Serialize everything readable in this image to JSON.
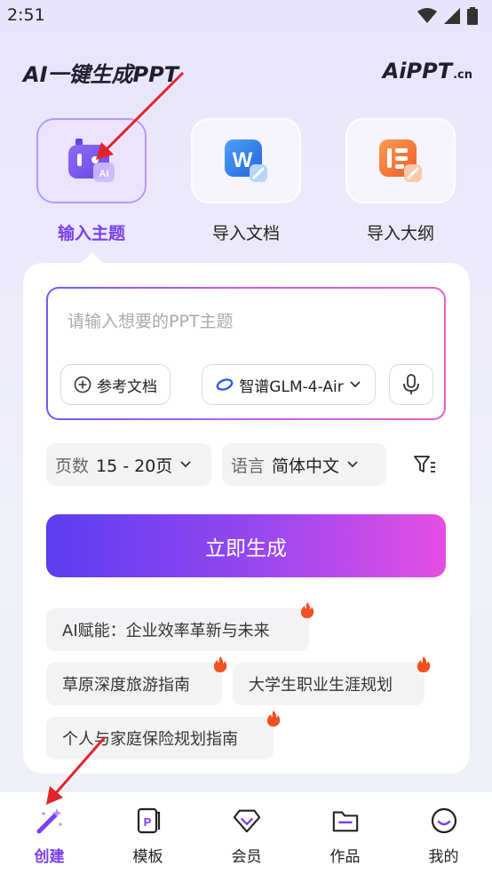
{
  "status_bar": {
    "time": "2:51"
  },
  "header": {
    "title": "AI一键生成PPT",
    "logo_main": "AiPPT",
    "logo_suffix": ".cn"
  },
  "modes": [
    {
      "label": "输入主题",
      "icon": "robot-ai-icon",
      "active": true
    },
    {
      "label": "导入文档",
      "icon": "word-doc-icon",
      "active": false
    },
    {
      "label": "导入大纲",
      "icon": "outline-doc-icon",
      "active": false
    }
  ],
  "prompt": {
    "placeholder": "请输入想要的PPT主题",
    "reference_button": "参考文档",
    "model_selector": "智谱GLM-4-Air"
  },
  "options": {
    "pages_label": "页数",
    "pages_value": "15 - 20页",
    "language_label": "语言",
    "language_value": "简体中文"
  },
  "generate_button": "立即生成",
  "suggestions": [
    "AI赋能：企业效率革新与未来",
    "草原深度旅游指南",
    "大学生职业生涯规划",
    "个人与家庭保险规划指南"
  ],
  "bottom_nav": [
    {
      "label": "创建",
      "icon": "magic-wand-icon",
      "active": true
    },
    {
      "label": "模板",
      "icon": "ppt-template-icon",
      "active": false
    },
    {
      "label": "会员",
      "icon": "diamond-icon",
      "active": false
    },
    {
      "label": "作品",
      "icon": "folder-icon",
      "active": false
    },
    {
      "label": "我的",
      "icon": "smiley-icon",
      "active": false
    }
  ],
  "colors": {
    "accent": "#7b3ff0",
    "gradient_start": "#5b3df0",
    "gradient_end": "#e54fe3",
    "annotation_arrow": "#e0242b"
  }
}
